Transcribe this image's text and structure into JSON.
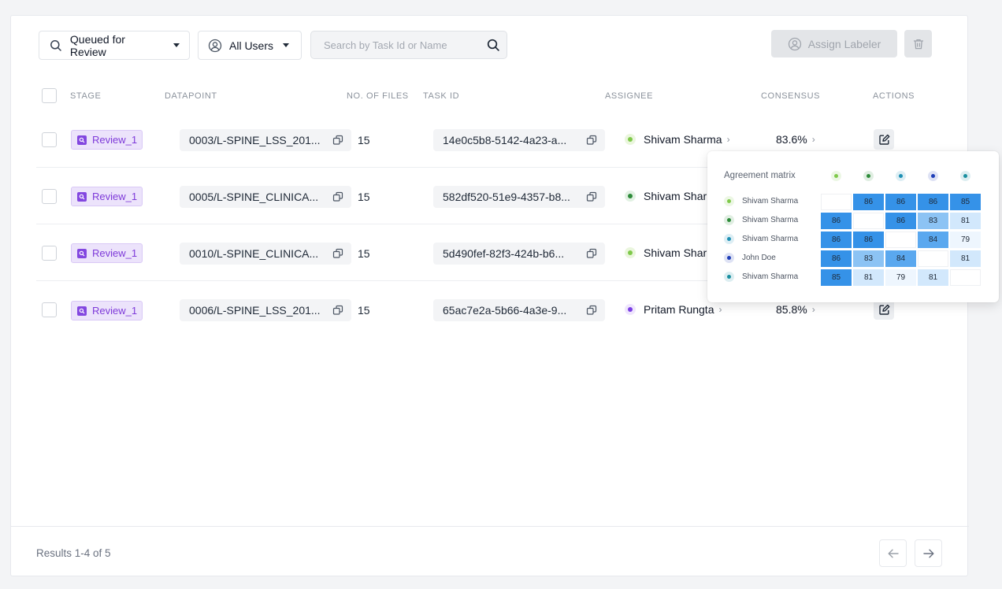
{
  "filters": {
    "stage_filter": "Queued for Review",
    "user_filter": "All Users",
    "search_placeholder": "Search by Task Id or Name",
    "assign_label": "Assign Labeler"
  },
  "columns": [
    "Stage",
    "Datapoint",
    "No. of Files",
    "Task ID",
    "Assignee",
    "Consensus",
    "Actions"
  ],
  "rows": [
    {
      "stage": "Review_1",
      "datapoint": "0003/L-SPINE_LSS_201...",
      "files": "15",
      "task_id": "14e0c5b8-5142-4a23-a...",
      "assignee": "Shivam Sharma",
      "assignee_color": "#7fc94a",
      "consensus": "83.6%"
    },
    {
      "stage": "Review_1",
      "datapoint": "0005/L-SPINE_CLINICA...",
      "files": "15",
      "task_id": "582df520-51e9-4357-b8...",
      "assignee": "Shivam Sharm",
      "assignee_color": "#2e8b3a",
      "consensus": ""
    },
    {
      "stage": "Review_1",
      "datapoint": "0010/L-SPINE_CLINICA...",
      "files": "15",
      "task_id": "5d490fef-82f3-424b-b6...",
      "assignee": "Shivam Sharm",
      "assignee_color": "#7fc94a",
      "consensus": ""
    },
    {
      "stage": "Review_1",
      "datapoint": "0006/L-SPINE_LSS_201...",
      "files": "15",
      "task_id": "65ac7e2a-5b66-4a3e-9...",
      "assignee": "Pritam Rungta",
      "assignee_color": "#7b3fe4",
      "consensus": "85.8%"
    }
  ],
  "agreement_matrix": {
    "title": "Agreement matrix",
    "users": [
      {
        "name": "Shivam Sharma",
        "color": "#7fc94a"
      },
      {
        "name": "Shivam Sharma",
        "color": "#2e8b3a"
      },
      {
        "name": "Shivam Sharma",
        "color": "#1e90b4"
      },
      {
        "name": "John Doe",
        "color": "#1f3fb8"
      },
      {
        "name": "Shivam Sharma",
        "color": "#1a8fa0"
      }
    ],
    "values": [
      [
        "",
        "86",
        "86",
        "86",
        "85"
      ],
      [
        "86",
        "",
        "86",
        "83",
        "81"
      ],
      [
        "86",
        "86",
        "",
        "84",
        "79"
      ],
      [
        "86",
        "83",
        "84",
        "",
        "81"
      ],
      [
        "85",
        "81",
        "79",
        "81",
        ""
      ]
    ]
  },
  "footer": {
    "results": "Results 1-4 of 5"
  },
  "colors": {
    "accent_purple": "#7e3ad9",
    "matrix_high": "#3592e8",
    "matrix_low": "#dbeefd"
  }
}
